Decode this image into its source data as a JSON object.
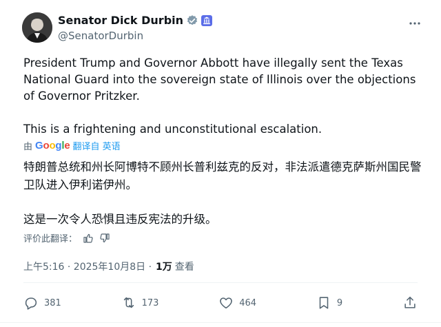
{
  "author": {
    "name": "Senator Dick Durbin",
    "handle": "@SenatorDurbin",
    "verified_color": "#829aab",
    "gov_badge_color": "#5b6de8"
  },
  "more_icon": "ellipsis-icon",
  "tweet": {
    "paragraphs": [
      "President Trump and Governor Abbott have illegally sent the Texas National Guard into the sovereign state of Illinois over the objections of Governor Pritzker.",
      "This is a frightening and unconstitutional escalation."
    ]
  },
  "translation": {
    "by": "由",
    "provider": "Google",
    "link": "翻译自 英语",
    "paragraphs": [
      "特朗普总统和州长阿博特不顾州长普利兹克的反对，非法派遣德克萨斯州国民警卫队进入伊利诺伊州。",
      "这是一次令人恐惧且违反宪法的升级。"
    ],
    "rate_label": "评价此翻译："
  },
  "meta": {
    "time": "上午5:16 · 2025年10月8日 ·",
    "views": "1万",
    "views_label": "查看"
  },
  "actions": {
    "replies": "381",
    "reposts": "173",
    "likes": "464",
    "bookmarks": "9"
  },
  "colors": {
    "text": "#0f1419",
    "muted": "#536471",
    "link": "#1d9bf0"
  }
}
